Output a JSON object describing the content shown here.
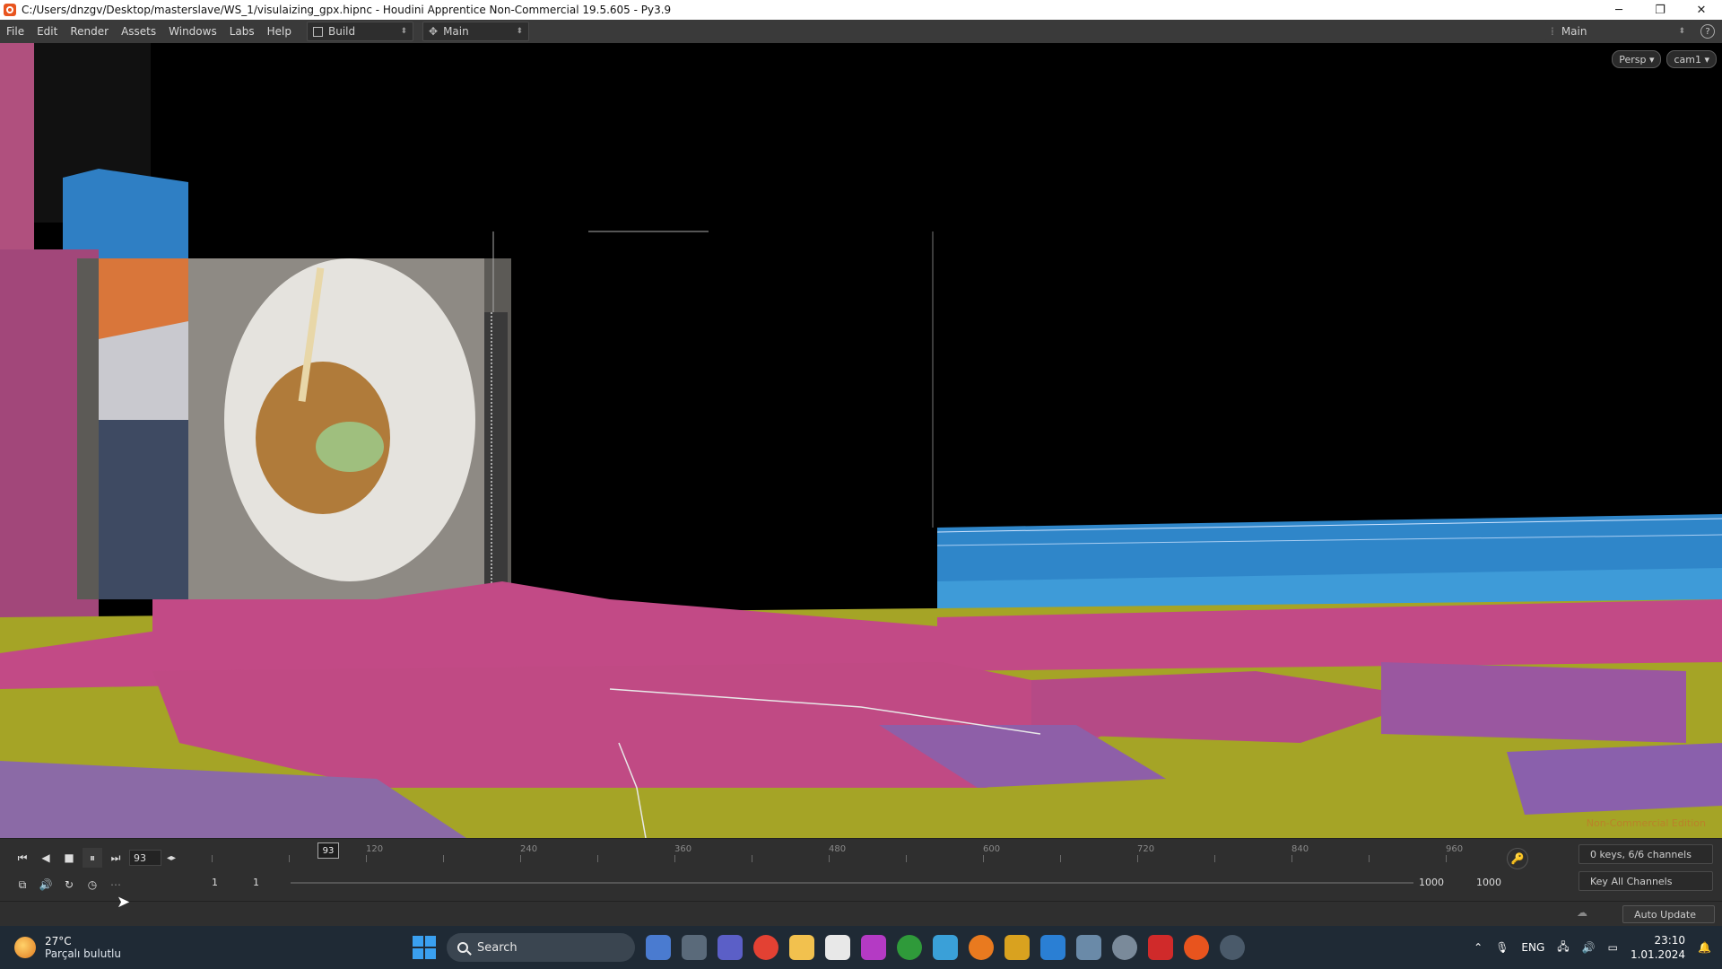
{
  "window": {
    "title": "C:/Users/dnzgv/Desktop/masterslave/WS_1/visulaizing_gpx.hipnc - Houdini Apprentice Non-Commercial 19.5.605 - Py3.9",
    "minimize": "─",
    "maximize": "❐",
    "close": "✕"
  },
  "menu": {
    "items": [
      "File",
      "Edit",
      "Render",
      "Assets",
      "Windows",
      "Labs",
      "Help"
    ],
    "desktop1": "Build",
    "desktop2": "Main",
    "desktop_right": "Main"
  },
  "viewport": {
    "persp_label": "Persp ▾",
    "cam_label": "cam1 ▾",
    "watermark": "Non-Commercial Edition"
  },
  "timeline": {
    "current_frame": "93",
    "playhead_frame": "93",
    "ticks": [
      "120",
      "240",
      "360",
      "480",
      "600",
      "720",
      "840",
      "960"
    ],
    "range_start_a": "1",
    "range_start_b": "1",
    "range_end_a": "1000",
    "range_end_b": "1000",
    "keys_status": "0 keys, 6/6 channels",
    "key_all": "Key All Channels",
    "auto_update": "Auto Update"
  },
  "taskbar": {
    "weather_temp": "27°C",
    "weather_desc": "Parçalı bulutlu",
    "search_placeholder": "Search",
    "lang": "ENG",
    "time": "23:10",
    "date": "1.01.2024"
  },
  "colors": {
    "terrain_pink": "#c24a86",
    "terrain_olive": "#a5a426",
    "terrain_blue": "#2f86c9",
    "accent_orange": "#e8541e"
  }
}
